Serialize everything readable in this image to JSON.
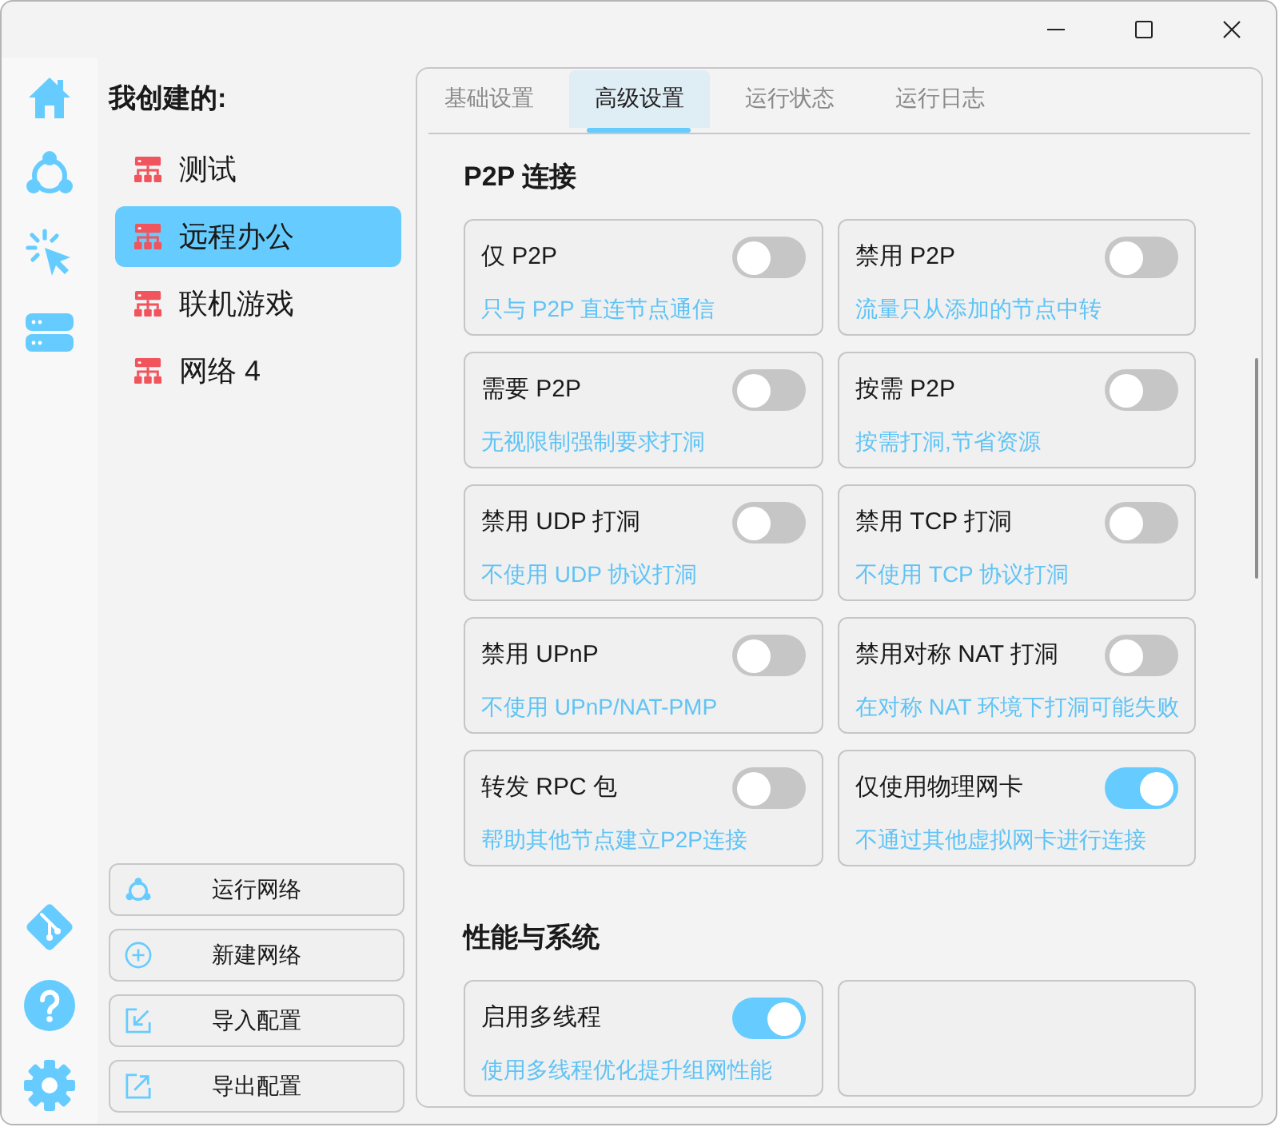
{
  "sidebar": {
    "heading": "我创建的:",
    "networks": [
      {
        "label": "测试",
        "selected": false
      },
      {
        "label": "远程办公",
        "selected": true
      },
      {
        "label": "联机游戏",
        "selected": false
      },
      {
        "label": "网络 4",
        "selected": false
      }
    ],
    "actions": [
      {
        "kind": "run",
        "label": "运行网络"
      },
      {
        "kind": "new",
        "label": "新建网络"
      },
      {
        "kind": "import",
        "label": "导入配置"
      },
      {
        "kind": "export",
        "label": "导出配置"
      }
    ]
  },
  "tabs": [
    {
      "label": "基础设置",
      "selected": false
    },
    {
      "label": "高级设置",
      "selected": true
    },
    {
      "label": "运行状态",
      "selected": false
    },
    {
      "label": "运行日志",
      "selected": false
    }
  ],
  "sections": [
    {
      "title": "P2P 连接",
      "settings": [
        {
          "title": "仅 P2P",
          "description": "只与 P2P 直连节点通信",
          "on": false
        },
        {
          "title": "禁用 P2P",
          "description": "流量只从添加的节点中转",
          "on": false
        },
        {
          "title": "需要 P2P",
          "description": "无视限制强制要求打洞",
          "on": false
        },
        {
          "title": "按需 P2P",
          "description": "按需打洞,节省资源",
          "on": false
        },
        {
          "title": "禁用 UDP 打洞",
          "description": "不使用 UDP 协议打洞",
          "on": false
        },
        {
          "title": "禁用 TCP 打洞",
          "description": "不使用 TCP 协议打洞",
          "on": false
        },
        {
          "title": "禁用 UPnP",
          "description": "不使用 UPnP/NAT-PMP",
          "on": false
        },
        {
          "title": "禁用对称 NAT 打洞",
          "description": "在对称 NAT 环境下打洞可能失败",
          "on": false
        },
        {
          "title": "转发 RPC 包",
          "description": "帮助其他节点建立P2P连接",
          "on": false
        },
        {
          "title": "仅使用物理网卡",
          "description": "不通过其他虚拟网卡进行连接",
          "on": true
        }
      ]
    },
    {
      "title": "性能与系统",
      "settings": [
        {
          "title": "启用多线程",
          "description": "使用多线程优化提升组网性能",
          "on": true
        }
      ]
    }
  ]
}
